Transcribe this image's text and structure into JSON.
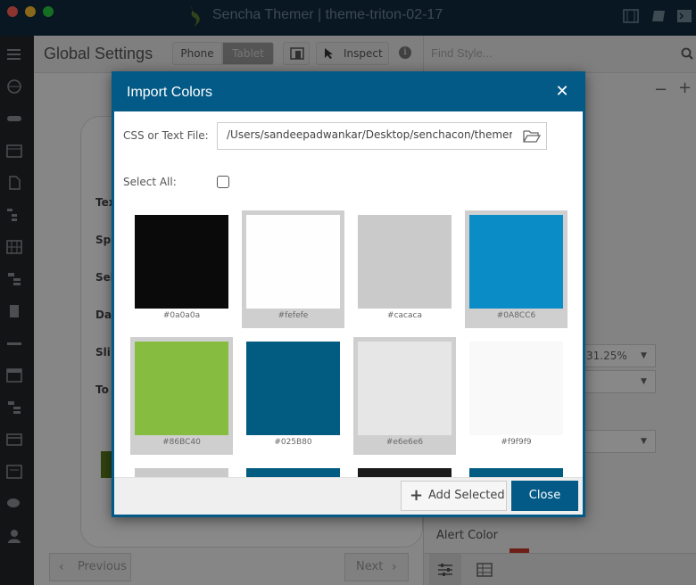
{
  "window": {
    "title": "Sencha Themer | theme-triton-02-17"
  },
  "toolbar": {
    "page_title": "Global Settings",
    "phone_label": "Phone",
    "tablet_label": "Tablet",
    "inspect_label": "Inspect"
  },
  "right_panel": {
    "find_placeholder": "Find Style...",
    "percent_value": "31.25%",
    "alert_label": "Alert Color"
  },
  "form": {
    "labels": [
      "Tex",
      "Spi",
      "Sel",
      "Da",
      "Sli",
      "To"
    ]
  },
  "bottom": {
    "previous_label": "Previous",
    "next_label": "Next"
  },
  "dialog": {
    "title": "Import Colors",
    "file_label": "CSS or Text File:",
    "file_value": "/Users/sandeepadwankar/Desktop/senchacon/themer",
    "select_all_label": "Select All:",
    "add_selected_label": "Add Selected",
    "close_label": "Close",
    "swatches": [
      {
        "hex": "#0a0a0a",
        "color": "#0a0a0a",
        "selected": false
      },
      {
        "hex": "#fefefe",
        "color": "#fefefe",
        "selected": true
      },
      {
        "hex": "#cacaca",
        "color": "#cacaca",
        "selected": false
      },
      {
        "hex": "#0A8CC6",
        "color": "#0A8CC6",
        "selected": true
      },
      {
        "hex": "#86BC40",
        "color": "#86BC40",
        "selected": true
      },
      {
        "hex": "#025B80",
        "color": "#025B80",
        "selected": false
      },
      {
        "hex": "#e6e6e6",
        "color": "#e6e6e6",
        "selected": true
      },
      {
        "hex": "#f9f9f9",
        "color": "#f9f9f9",
        "selected": false
      },
      {
        "hex": "",
        "color": "#cacaca",
        "selected": false
      },
      {
        "hex": "",
        "color": "#025B80",
        "selected": false
      },
      {
        "hex": "",
        "color": "#1a1a1a",
        "selected": false
      },
      {
        "hex": "",
        "color": "#025B80",
        "selected": false
      }
    ]
  },
  "colors": {
    "accent": "#035a86",
    "titlebar": "#0f2a3c",
    "rail": "#232629"
  }
}
